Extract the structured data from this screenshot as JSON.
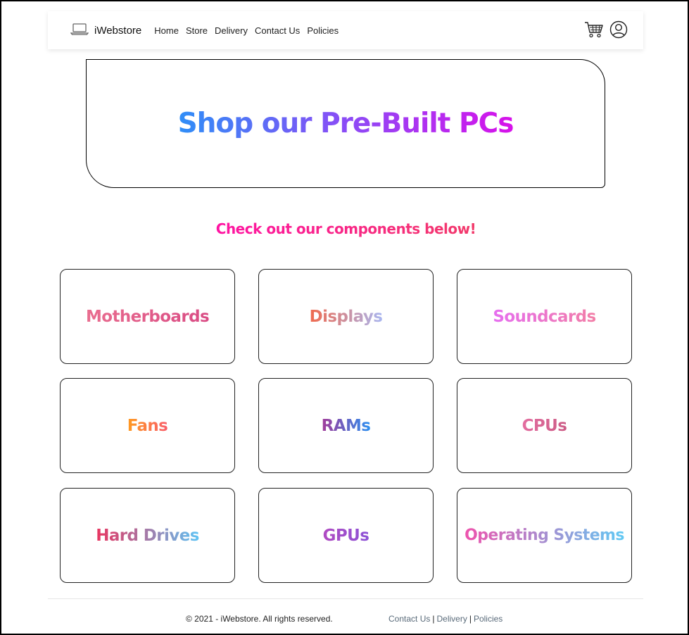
{
  "navbar": {
    "brand_text": "iWebstore",
    "links": [
      "Home",
      "Store",
      "Delivery",
      "Contact Us",
      "Policies"
    ],
    "icons": [
      "laptop-icon",
      "cart-icon",
      "user-icon"
    ]
  },
  "hero": {
    "title": "Shop our Pre-Built PCs"
  },
  "subtitle": "Check out our components below!",
  "categories": [
    {
      "label": "Motherboards",
      "grad": [
        "#e96d8f",
        "#d94b84"
      ]
    },
    {
      "label": "Displays",
      "grad": [
        "#f06a4e",
        "#a9b6f0"
      ]
    },
    {
      "label": "Soundcards",
      "grad": [
        "#e66ef0",
        "#f27ea6"
      ]
    },
    {
      "label": "Fans",
      "grad": [
        "#ff9a20",
        "#f95e6a"
      ]
    },
    {
      "label": "RAMs",
      "grad": [
        "#a23c9a",
        "#2d8ff0"
      ]
    },
    {
      "label": "CPUs",
      "grad": [
        "#e36ea0",
        "#cc5c86"
      ]
    },
    {
      "label": "Hard Drives",
      "grad": [
        "#e9345f",
        "#5ec3f4"
      ]
    },
    {
      "label": "GPUs",
      "grad": [
        "#b04bc2",
        "#8c52d6"
      ]
    },
    {
      "label": "Operating Systems",
      "grad": [
        "#ee53ad",
        "#61c9f4"
      ]
    }
  ],
  "footer": {
    "copyright": "© 2021 - iWebstore. All rights reserved.",
    "links": [
      "Contact Us",
      "Delivery",
      "Policies"
    ],
    "separator": "|"
  }
}
